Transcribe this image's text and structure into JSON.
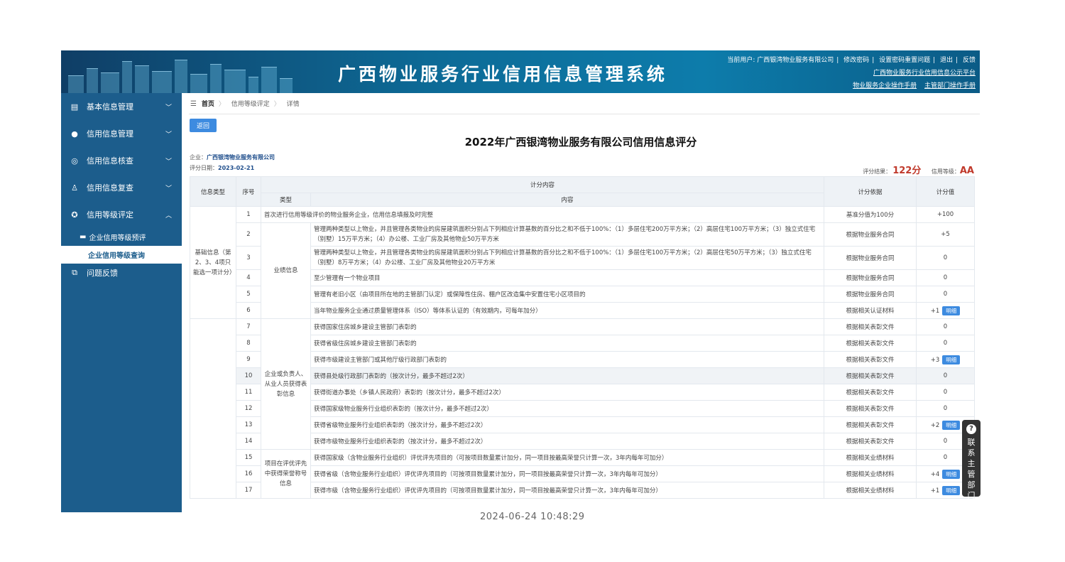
{
  "header": {
    "title": "广西物业服务行业信用信息管理系统",
    "current_user_label": "当前用户:",
    "current_user": "广西银湾物业服务有限公司",
    "links": [
      "修改密码",
      "设置密码重置问题",
      "退出",
      "反馈"
    ],
    "platform_link": "广西物业服务行业信用信息公示平台",
    "manual_links": [
      "物业服务企业操作手册",
      "主管部门操作手册"
    ]
  },
  "sidebar": {
    "items": [
      {
        "label": "基本信息管理",
        "icon": "document-icon"
      },
      {
        "label": "信用信息管理",
        "icon": "user-icon"
      },
      {
        "label": "信用信息核查",
        "icon": "target-icon"
      },
      {
        "label": "信用信息复查",
        "icon": "person-icon"
      },
      {
        "label": "信用等级评定",
        "icon": "badge-icon"
      }
    ],
    "sub_items": [
      "企业信用等级预评",
      "企业信用等级查询"
    ],
    "feedback": "问题反馈"
  },
  "breadcrumb": {
    "home": "首页",
    "level1": "信用等级评定",
    "level2": "详情"
  },
  "back_label": "返回",
  "report": {
    "title": "2022年广西银湾物业服务有限公司信用信息评分",
    "company_label": "企业：",
    "company": "广西银湾物业服务有限公司",
    "date_label": "评分日期：",
    "date": "2023-02-21",
    "result_label": "评分结果：",
    "result": "122分",
    "level_label": "信用等级：",
    "level": "AA"
  },
  "table": {
    "headers": {
      "info_type": "信息类型",
      "seq": "序号",
      "score_content": "计分内容",
      "type": "类型",
      "content": "内容",
      "basis": "计分依据",
      "value": "计分值"
    },
    "groups": {
      "basic": "基础信息（第2、3、4项只能选一项计分）",
      "performance": "业绩信息",
      "honor_person": "企业或负责人、从业人员获得表彰信息",
      "honor_project": "项目在评优评先中获得荣誉称号信息"
    },
    "detail_label": "明细",
    "rows": [
      {
        "seq": "1",
        "content": "首次进行信用等级评价的物业服务企业，信用信息填报及时完整",
        "basis": "基准分值为100分",
        "value": "+100",
        "detail": false
      },
      {
        "seq": "2",
        "content": "管理两种类型以上物业，并且管理各类物业的房屋建筑面积分别占下列相应计算基数的百分比之和不低于100%：（1）多层住宅200万平方米；（2）高层住宅100万平方米；（3）独立式住宅（别墅）15万平方米；（4）办公楼、工业厂房及其他物业50万平方米",
        "basis": "根据物业服务合同",
        "value": "+5",
        "detail": false
      },
      {
        "seq": "3",
        "content": "管理两种类型以上物业，并且管理各类物业的房屋建筑面积分别占下列相应计算基数的百分比之和不低于100%：（1）多层住宅100万平方米；（2）高层住宅50万平方米；（3）独立式住宅（别墅）8万平方米；（4）办公楼、工业厂房及其他物业20万平方米",
        "basis": "根据物业服务合同",
        "value": "0",
        "detail": false
      },
      {
        "seq": "4",
        "content": "至少管理有一个物业项目",
        "basis": "根据物业服务合同",
        "value": "0",
        "detail": false
      },
      {
        "seq": "5",
        "content": "管理有老旧小区（由项目所在地的主管部门认定）或保障性住房、棚户区改造集中安置住宅小区项目的",
        "basis": "根据物业服务合同",
        "value": "0",
        "detail": false
      },
      {
        "seq": "6",
        "content": "当年物业服务企业通过质量管理体系（ISO）等体系认证的（有效期内，可每年加分）",
        "basis": "根据相关认证材料",
        "value": "+1",
        "detail": true
      },
      {
        "seq": "7",
        "content": "获得国家住房城乡建设主管部门表彰的",
        "basis": "根据相关表彰文件",
        "value": "0",
        "detail": false
      },
      {
        "seq": "8",
        "content": "获得省级住房城乡建设主管部门表彰的",
        "basis": "根据相关表彰文件",
        "value": "0",
        "detail": false
      },
      {
        "seq": "9",
        "content": "获得市级建设主管部门或其他厅级行政部门表彰的",
        "basis": "根据相关表彰文件",
        "value": "+3",
        "detail": true
      },
      {
        "seq": "10",
        "content": "获得县处级行政部门表彰的（按次计分，最多不超过2次）",
        "basis": "根据相关表彰文件",
        "value": "0",
        "detail": false
      },
      {
        "seq": "11",
        "content": "获得街道办事处（乡镇人民政府）表彰的（按次计分，最多不超过2次）",
        "basis": "根据相关表彰文件",
        "value": "0",
        "detail": false
      },
      {
        "seq": "12",
        "content": "获得国家级物业服务行业组织表彰的（按次计分，最多不超过2次）",
        "basis": "根据相关表彰文件",
        "value": "0",
        "detail": false
      },
      {
        "seq": "13",
        "content": "获得省级物业服务行业组织表彰的（按次计分，最多不超过2次）",
        "basis": "根据相关表彰文件",
        "value": "+2",
        "detail": true
      },
      {
        "seq": "14",
        "content": "获得市级物业服务行业组织表彰的（按次计分，最多不超过2次）",
        "basis": "根据相关表彰文件",
        "value": "0",
        "detail": false
      },
      {
        "seq": "15",
        "content": "获得国家级（含物业服务行业组织）评优评先项目的（可按项目数量累计加分，同一项目按最高荣誉只计算一次，3年内每年可加分）",
        "basis": "根据相关业绩材料",
        "value": "0",
        "detail": false
      },
      {
        "seq": "16",
        "content": "获得省级（含物业服务行业组织）评优评先项目的（可按项目数量累计加分，同一项目按最高荣誉只计算一次，3年内每年可加分）",
        "basis": "根据相关业绩材料",
        "value": "+4",
        "detail": true
      },
      {
        "seq": "17",
        "content": "获得市级（含物业服务行业组织）评优评先项目的（可按项目数量累计加分，同一项目按最高荣誉只计算一次，3年内每年可加分）",
        "basis": "根据相关业绩材料",
        "value": "+1",
        "detail": true
      }
    ]
  },
  "contact": {
    "label": "联系主管部门"
  },
  "timestamp": "2024-06-24 10:48:29",
  "colors": {
    "primary": "#3d8be0",
    "sidebar": "#1c5d8c",
    "accent": "#c0392b"
  }
}
